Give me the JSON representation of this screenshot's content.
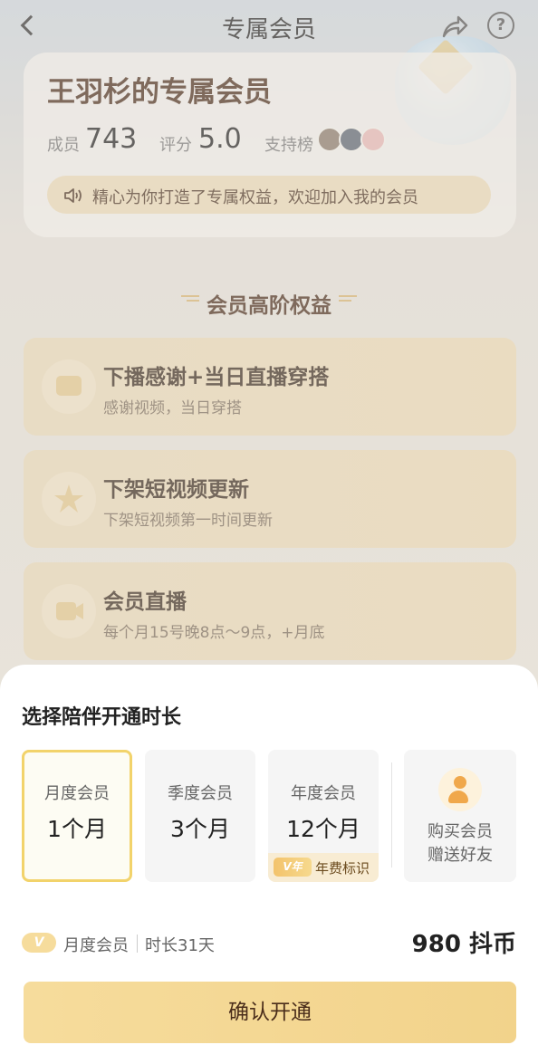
{
  "header": {
    "title": "专属会员"
  },
  "card": {
    "title": "王羽杉的专属会员",
    "members_label": "成员",
    "members_value": "743",
    "rating_label": "评分",
    "rating_value": "5.0",
    "support_label": "支持榜",
    "notice": "精心为你打造了专属权益，欢迎加入我的会员"
  },
  "benefits_title": "会员高阶权益",
  "benefits": [
    {
      "title": "下播感谢+当日直播穿搭",
      "subtitle": "感谢视频，当日穿搭"
    },
    {
      "title": "下架短视频更新",
      "subtitle": "下架短视频第一时间更新"
    },
    {
      "title": "会员直播",
      "subtitle": "每个月15号晚8点～9点，+月底"
    }
  ],
  "sheet": {
    "title": "选择陪伴开通时长",
    "plans": [
      {
        "name": "月度会员",
        "duration": "1个月",
        "selected": true
      },
      {
        "name": "季度会员",
        "duration": "3个月",
        "selected": false
      },
      {
        "name": "年度会员",
        "duration": "12个月",
        "selected": false,
        "badge": "V年",
        "tag": "年费标识"
      }
    ],
    "gift": {
      "line1": "购买会员",
      "line2": "赠送好友"
    },
    "summary": {
      "badge": "V",
      "plan": "月度会员",
      "duration": "时长31天",
      "price": "980 抖币"
    },
    "confirm": "确认开通"
  },
  "colors": {
    "accent_gold": "#f2d36b",
    "button": "#f6dc9c",
    "title_brown": "#4a2d1b"
  }
}
